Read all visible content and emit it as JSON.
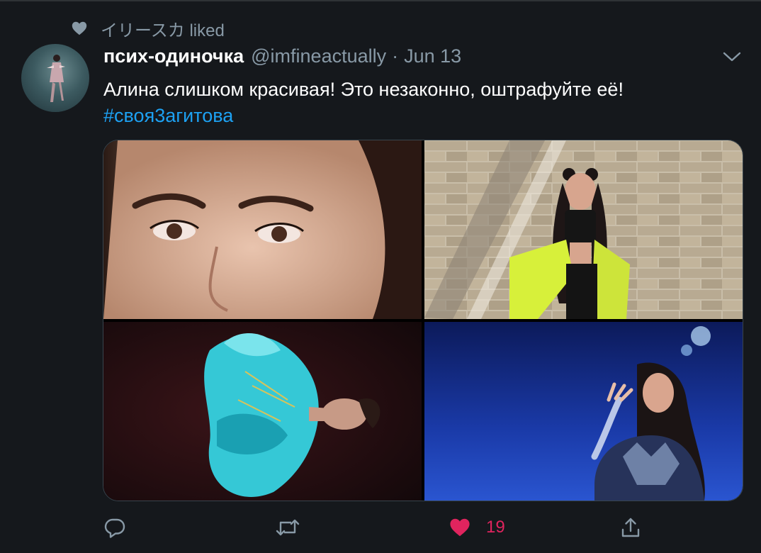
{
  "social_context": {
    "text": "イリースカ liked"
  },
  "tweet": {
    "display_name": "псих-одиночка",
    "handle": "@imfineactually",
    "separator": "·",
    "date": "Jun 13",
    "text": "Алина слишком красивая! Это незаконно, оштрафуйте её!",
    "hashtag": "#своя3агитова"
  },
  "media": [
    {
      "name": "photo-closeup-face"
    },
    {
      "name": "photo-brick-wall-pose"
    },
    {
      "name": "photo-skating-costume"
    },
    {
      "name": "photo-ice-performance"
    }
  ],
  "actions": {
    "reply": {
      "icon": "reply-icon"
    },
    "retweet": {
      "icon": "retweet-icon"
    },
    "like": {
      "icon": "heart-filled-icon",
      "count": "19",
      "color": "#e0245e"
    },
    "share": {
      "icon": "share-icon"
    }
  },
  "colors": {
    "background": "#15181c",
    "link": "#1da1f2",
    "muted": "#8899a6",
    "like": "#e0245e"
  }
}
